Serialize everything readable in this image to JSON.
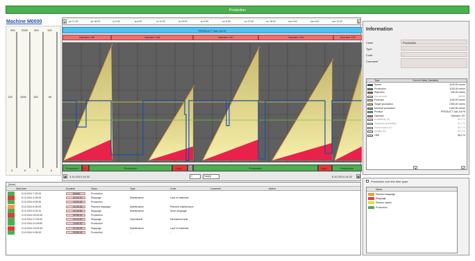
{
  "top_bar": {
    "label": "Production"
  },
  "machine": {
    "title": "Machine M0000"
  },
  "gauges": [
    {
      "top": "250",
      "mid": "125",
      "bottom": "0",
      "color": "#ffffff"
    },
    {
      "top": "2000",
      "mid": "1000",
      "bottom": "0",
      "color": "#1f4ea3"
    },
    {
      "top": "300",
      "mid": "150",
      "bottom": "0",
      "color": "#e6d93b"
    },
    {
      "top": "120",
      "mid": "60",
      "bottom": "0",
      "color": "#7fbf3f"
    }
  ],
  "timeaxis": {
    "ticks": [
      "pe 12:00",
      "pe 18:00",
      "la 0:00",
      "la 6:00",
      "la 12:00",
      "la 18:00",
      "su 0:00",
      "su 6:00",
      "su 12:00",
      "su 18:00",
      "ma 0:00",
      "ma 6:00",
      "ma 12:00"
    ]
  },
  "product_bar": {
    "label": "PRODUCT 2aA.10x76"
  },
  "operators": [
    "Operator 105",
    "Operator 106",
    "Operator 107",
    "Operator 106",
    "Operator 105"
  ],
  "states": [
    {
      "label": "Production",
      "color": "#4caf50"
    },
    {
      "label": "S...",
      "color": "#e53935"
    },
    {
      "label": "Production",
      "color": "#4caf50"
    },
    {
      "label": "Unpl...",
      "color": "#e53935"
    },
    {
      "label": "",
      "color": "#9e9e9e"
    },
    {
      "label": "Production",
      "color": "#4caf50"
    },
    {
      "label": "Unpl...",
      "color": "#e53935"
    },
    {
      "label": "Production",
      "color": "#4caf50"
    }
  ],
  "bottom_controls": {
    "start_date": "3.10.2014 14:32",
    "page": "1",
    "period": "Day(s)",
    "end_date": "6.10.2014 14:32"
  },
  "info": {
    "title": "Information",
    "fields": [
      {
        "label": "Class",
        "value": "Production"
      },
      {
        "label": "Type",
        "value": "-"
      },
      {
        "label": "Code",
        "value": "-"
      },
      {
        "label": "Comment",
        "value": ""
      }
    ],
    "table_headers": [
      "Type",
      "Current Value (Variable)"
    ],
    "variables": [
      {
        "name": "Speed",
        "value": "1130,00 m/min",
        "color": "#1f4ea3",
        "dim": false
      },
      {
        "name": "Production",
        "value": "1130,00 m/min",
        "color": "#4caf50",
        "dim": false
      },
      {
        "name": "Rejection",
        "value": "226,00 m/min",
        "color": "#e53935",
        "dim": false
      },
      {
        "name": "Set amount",
        "value": "(6800)",
        "color": "#ffffff",
        "dim": true
      },
      {
        "name": "Forecast",
        "value": "1130,00 m/min",
        "color": "#f2e5a0",
        "dim": false
      },
      {
        "name": "Target production",
        "value": "1350,00 m/min",
        "color": "#e6d93b",
        "dim": false
      },
      {
        "name": "Nominal production",
        "value": "1400,00 m/min",
        "color": "#7fbf3f",
        "dim": false
      },
      {
        "name": "Product",
        "value": "PRODUCT 1aA.10x76",
        "color": "#4fc3f7",
        "dim": false
      },
      {
        "name": "Operator",
        "value": "Operator 107",
        "color": "#ef6f6f",
        "dim": false
      },
      {
        "name": "Availability (A)",
        "value": "85,4 %",
        "color": "#ffffff",
        "dim": true
      },
      {
        "name": "Technical availability",
        "value": "91,2 %",
        "color": "#ffffff",
        "dim": true
      },
      {
        "name": "Performance (P)",
        "value": "80,4 %",
        "color": "#ffffff",
        "dim": true
      },
      {
        "name": "Quality (Q)",
        "value": "80,4 %",
        "color": "#ffffff",
        "dim": true
      },
      {
        "name": "OEE",
        "value": "56,0 %",
        "color": "#ffffff",
        "dim": false
      }
    ]
  },
  "events": {
    "group_label": "[None]",
    "headers": [
      "Start time",
      "Duration",
      "Class",
      "Type",
      "Code",
      "Comment",
      "Author"
    ],
    "rows": [
      {
        "color": "#4caf50",
        "start": "6.10.2014 7:29:20",
        "duration": "[None]",
        "class": "Production",
        "type": "",
        "code": ""
      },
      {
        "color": "#e53935",
        "start": "6.10.2014 4:09:00",
        "duration": "03:20:20",
        "class": "Stoppage",
        "type": "Maintenance",
        "code": "Lack of materials"
      },
      {
        "color": "#4caf50",
        "start": "5.10.2014 9:09:30",
        "duration": "19:00:30",
        "class": "Production",
        "type": "",
        "code": ""
      },
      {
        "color": "#f29b38",
        "start": "5.10.2014 6:30:00",
        "duration": "01:39:30",
        "class": "Planned stoppage",
        "type": "Maintenance",
        "code": "Planned maintenance"
      },
      {
        "color": "#4caf50",
        "start": "5.10.2014 6:29:10",
        "duration": "00:00:50",
        "class": "Stoppage",
        "type": "Maintenance",
        "code": "Short stoppage"
      },
      {
        "color": "#e53935",
        "start": "4.10.2014 20:29:40",
        "duration": "05:55:30",
        "class": "Production",
        "type": "",
        "code": ""
      },
      {
        "color": "#4caf50",
        "start": "4.10.2014 17:09:20",
        "duration": "03:20:20",
        "class": "Stoppage",
        "type": "Operational",
        "code": "Mechanical fault"
      },
      {
        "color": "#4caf50",
        "start": "3.10.2014 21:09:50",
        "duration": "19:59:30",
        "class": "Production",
        "type": "",
        "code": ""
      },
      {
        "color": "#e53935",
        "start": "3.10.2014 19:29:30",
        "duration": "01:40:20",
        "class": "Stoppage",
        "type": "Maintenance",
        "code": "Lack of materials"
      },
      {
        "color": "#4caf50",
        "start": "3.10.2014 9:30:00",
        "duration": "09:59:30",
        "class": "Production",
        "type": "-",
        "code": "-"
      }
    ]
  },
  "legend": {
    "checkbox_label": "Production over the time span",
    "header": "Name",
    "items": [
      {
        "name": "Planned stoppage",
        "color": "#f29b38"
      },
      {
        "name": "Stoppage",
        "color": "#e53935"
      },
      {
        "name": "Reduce speed",
        "color": "#e6d93b"
      },
      {
        "name": "Production",
        "color": "#4caf50"
      }
    ]
  }
}
